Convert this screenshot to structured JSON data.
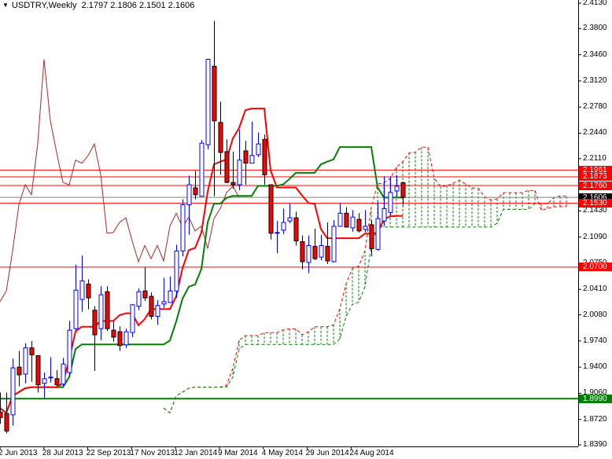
{
  "header": {
    "arrow": "▼",
    "symbol_timeframe": "USDTRY,Weekly",
    "ohlc": "2.1797 2.1806 2.1501 2.1606"
  },
  "chart_data": {
    "type": "candlestick",
    "symbol": "USDTRY",
    "timeframe": "Weekly",
    "indicator": "Ichimoku Kinko Hyo (9, 26, 52)",
    "ylim": [
      1.839,
      2.413
    ],
    "y_ticks": [
      "2.4130",
      "2.3800",
      "2.3460",
      "2.3120",
      "2.2780",
      "2.2440",
      "2.2110",
      "2.1430",
      "2.1090",
      "2.0750",
      "2.0410",
      "2.0080",
      "1.9740",
      "1.9400",
      "1.9060",
      "1.8720",
      "1.8390"
    ],
    "x_ticks": [
      "2 Jun 2013",
      "28 Jul 2013",
      "22 Sep 2013",
      "17 Nov 2013",
      "12 Jan 2014",
      "9 Mar 2014",
      "4 May 2014",
      "29 Jun 2014",
      "24 Aug 2014"
    ],
    "price_lines": [
      {
        "label": "2.1961",
        "value": 2.1961,
        "color": "#ff0000"
      },
      {
        "label": "2.1873",
        "value": 2.1873,
        "color": "#ff0000"
      },
      {
        "label": "2.1760",
        "value": 2.176,
        "color": "#ff0000"
      },
      {
        "label": "2.1530",
        "value": 2.153,
        "color": "#ff0000"
      },
      {
        "label": "2.0700",
        "value": 2.07,
        "color": "#ff0000"
      },
      {
        "label": "1.8990",
        "value": 1.899,
        "color": "#008000"
      }
    ],
    "bid": {
      "label": "2.1606",
      "value": 2.1606
    },
    "ohlc": [
      [
        1.8816,
        1.9071,
        1.8663,
        1.8745
      ],
      [
        1.8796,
        1.907,
        1.854,
        1.857
      ],
      [
        1.878,
        1.951,
        1.864,
        1.939
      ],
      [
        1.94,
        1.961,
        1.915,
        1.93
      ],
      [
        1.931,
        1.971,
        1.919,
        1.965
      ],
      [
        1.965,
        1.974,
        1.921,
        1.956
      ],
      [
        1.955,
        1.955,
        1.907,
        1.917
      ],
      [
        1.919,
        1.933,
        1.9,
        1.925
      ],
      [
        1.926,
        1.953,
        1.92,
        1.927
      ],
      [
        1.925,
        1.936,
        1.915,
        1.917
      ],
      [
        1.918,
        1.952,
        1.915,
        1.944
      ],
      [
        1.933,
        2.0,
        1.93,
        1.988
      ],
      [
        1.99,
        2.073,
        1.988,
        2.04
      ],
      [
        2.028,
        2.085,
        2.012,
        2.052
      ],
      [
        2.048,
        2.054,
        2.015,
        2.03
      ],
      [
        2.014,
        2.019,
        1.935,
        1.982
      ],
      [
        1.99,
        2.045,
        1.975,
        2.034
      ],
      [
        2.038,
        2.045,
        1.987,
        1.99
      ],
      [
        1.988,
        1.999,
        1.973,
        1.979
      ],
      [
        1.986,
        1.993,
        1.961,
        1.968
      ],
      [
        1.969,
        1.99,
        1.965,
        1.986
      ],
      [
        1.985,
        2.022,
        1.979,
        2.021
      ],
      [
        2.019,
        2.042,
        2.014,
        2.038
      ],
      [
        2.039,
        2.07,
        2.026,
        2.03
      ],
      [
        2.032,
        2.037,
        2.002,
        2.006
      ],
      [
        2.006,
        2.027,
        1.995,
        2.02
      ],
      [
        2.022,
        2.056,
        2.017,
        2.025
      ],
      [
        2.024,
        2.058,
        2.024,
        2.039
      ],
      [
        2.039,
        2.099,
        2.03,
        2.091
      ],
      [
        2.091,
        2.158,
        2.084,
        2.151
      ],
      [
        2.151,
        2.189,
        2.112,
        2.177
      ],
      [
        2.173,
        2.195,
        2.158,
        2.164
      ],
      [
        2.162,
        2.235,
        2.162,
        2.231
      ],
      [
        2.229,
        2.341,
        2.223,
        2.34
      ],
      [
        2.331,
        2.39,
        2.162,
        2.26
      ],
      [
        2.258,
        2.285,
        2.19,
        2.219
      ],
      [
        2.22,
        2.236,
        2.179,
        2.18
      ],
      [
        2.18,
        2.22,
        2.172,
        2.177
      ],
      [
        2.177,
        2.249,
        2.17,
        2.209
      ],
      [
        2.221,
        2.234,
        2.177,
        2.205
      ],
      [
        2.205,
        2.259,
        2.205,
        2.215
      ],
      [
        2.216,
        2.245,
        2.213,
        2.23
      ],
      [
        2.236,
        2.242,
        2.177,
        2.19
      ],
      [
        2.177,
        2.177,
        2.106,
        2.114
      ],
      [
        2.114,
        2.13,
        2.088,
        2.115
      ],
      [
        2.118,
        2.146,
        2.113,
        2.128
      ],
      [
        2.13,
        2.153,
        2.127,
        2.134
      ],
      [
        2.134,
        2.142,
        2.098,
        2.104
      ],
      [
        2.103,
        2.111,
        2.067,
        2.077
      ],
      [
        2.076,
        2.111,
        2.062,
        2.098
      ],
      [
        2.097,
        2.12,
        2.079,
        2.081
      ],
      [
        2.083,
        2.112,
        2.079,
        2.098
      ],
      [
        2.097,
        2.128,
        2.074,
        2.078
      ],
      [
        2.077,
        2.131,
        2.076,
        2.123
      ],
      [
        2.123,
        2.153,
        2.123,
        2.14
      ],
      [
        2.14,
        2.148,
        2.122,
        2.122
      ],
      [
        2.121,
        2.144,
        2.116,
        2.135
      ],
      [
        2.132,
        2.14,
        2.115,
        2.117
      ],
      [
        2.119,
        2.144,
        2.115,
        2.123
      ],
      [
        2.125,
        2.131,
        2.084,
        2.094
      ],
      [
        2.093,
        2.155,
        2.091,
        2.133
      ],
      [
        2.13,
        2.188,
        2.124,
        2.146
      ],
      [
        2.141,
        2.188,
        2.137,
        2.167
      ],
      [
        2.169,
        2.189,
        2.162,
        2.175
      ],
      [
        2.1797,
        2.1806,
        2.1501,
        2.1606
      ]
    ],
    "colors": {
      "bull": "#0000ff",
      "bear": "#ff0000",
      "tenkan": "#ff0000",
      "kijun": "#008000",
      "chikou": "#a52a2a",
      "cloud": "#008000"
    }
  }
}
